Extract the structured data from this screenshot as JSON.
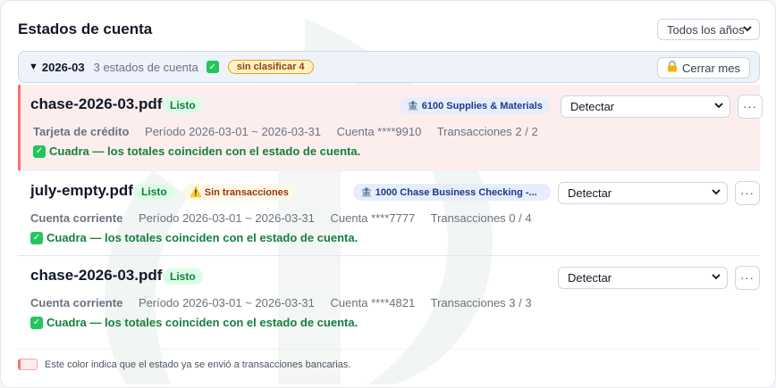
{
  "header": {
    "title": "Estados de cuenta",
    "year_filter": "Todos los años"
  },
  "month_group": {
    "month": "2026-03",
    "count_text": "3 estados de cuenta",
    "unclassified_badge": "sin clasificar 4",
    "close_button": "Cerrar mes"
  },
  "statements": [
    {
      "file_name": "chase-2026-03.pdf",
      "status_badge": "Listo",
      "warning_badge": "",
      "account_badge": "6100 Supplies & Materials",
      "detect_value": "Detectar",
      "account_type": "Tarjeta de crédito",
      "period": "Período 2026-03-01 ~ 2026-03-31",
      "account_number": "Cuenta ****9910",
      "transactions": "Transacciones 2 / 2",
      "result": "Cuadra — los totales coinciden con el estado de cuenta.",
      "sent": true
    },
    {
      "file_name": "july-empty.pdf",
      "status_badge": "Listo",
      "warning_badge": "Sin transacciones",
      "account_badge": "1000 Chase Business Checking -...",
      "detect_value": "Detectar",
      "account_type": "Cuenta corriente",
      "period": "Período 2026-03-01 ~ 2026-03-31",
      "account_number": "Cuenta ****7777",
      "transactions": "Transacciones 0 / 4",
      "result": "Cuadra — los totales coinciden con el estado de cuenta.",
      "sent": false
    },
    {
      "file_name": "chase-2026-03.pdf",
      "status_badge": "Listo",
      "warning_badge": "",
      "account_badge": "",
      "detect_value": "Detectar",
      "account_type": "Cuenta corriente",
      "period": "Período 2026-03-01 ~ 2026-03-31",
      "account_number": "Cuenta ****4821",
      "transactions": "Transacciones 3 / 3",
      "result": "Cuadra — los totales coinciden con el estado de cuenta.",
      "sent": false
    }
  ],
  "legend": {
    "text": "Este color indica que el estado ya se envió a transacciones bancarias."
  },
  "colors": {
    "sent_row_bg": "#fdeeee",
    "sent_row_border": "#f87171",
    "ready_green": "#15803d",
    "account_blue": "#1e3a8a"
  },
  "icons": {
    "lock": "lock-icon",
    "bank": "bank-icon",
    "warning": "warning-icon",
    "check": "check-icon"
  }
}
